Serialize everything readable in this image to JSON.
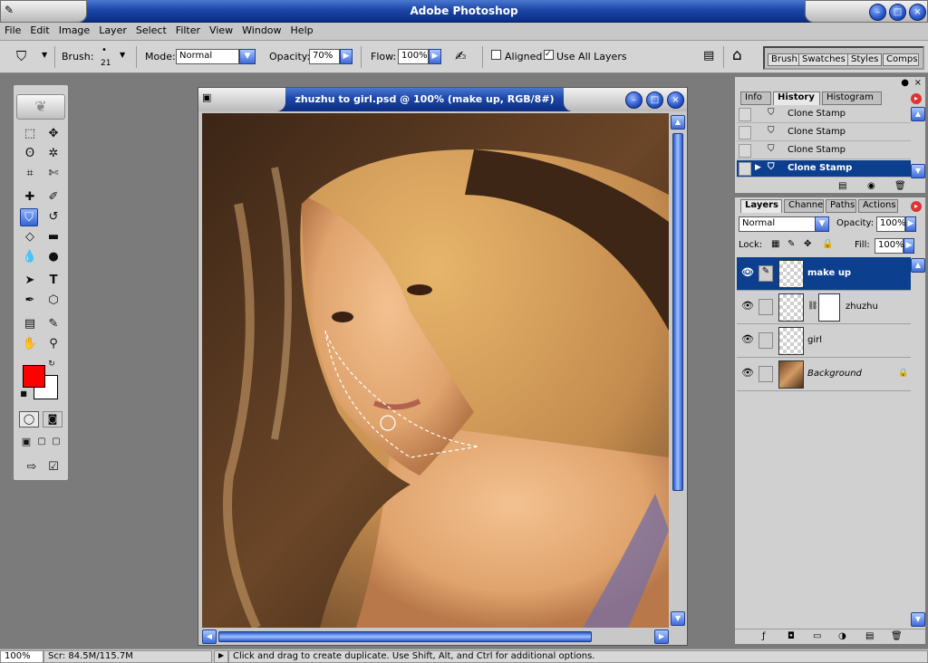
{
  "app": {
    "title": "Adobe Photoshop"
  },
  "menu": [
    "File",
    "Edit",
    "Image",
    "Layer",
    "Select",
    "Filter",
    "View",
    "Window",
    "Help"
  ],
  "options": {
    "brush_label": "Brush:",
    "brush_size": "21",
    "mode_label": "Mode:",
    "mode_value": "Normal",
    "opacity_label": "Opacity:",
    "opacity_value": "70%",
    "flow_label": "Flow:",
    "flow_value": "100%",
    "aligned_label": "Aligned",
    "use_all_layers_label": "Use All Layers",
    "well_tabs": [
      "Brush",
      "Swatches",
      "Styles",
      "Comps"
    ]
  },
  "document": {
    "title": "zhuzhu to girl.psd @ 100% (make up, RGB/8#)"
  },
  "history": {
    "tabs": [
      "Info",
      "History",
      "Histogram"
    ],
    "items": [
      "Clone Stamp",
      "Clone Stamp",
      "Clone Stamp",
      "Clone Stamp"
    ]
  },
  "layers": {
    "tabs": [
      "Layers",
      "Channels",
      "Paths",
      "Actions"
    ],
    "blend_mode": "Normal",
    "opacity_label": "Opacity:",
    "opacity_value": "100%",
    "lock_label": "Lock:",
    "fill_label": "Fill:",
    "fill_value": "100%",
    "items": [
      {
        "name": "make up"
      },
      {
        "name": "zhuzhu"
      },
      {
        "name": "girl"
      },
      {
        "name": "Background"
      }
    ]
  },
  "status": {
    "zoom": "100%",
    "scratch": "Scr: 84.5M/115.7M",
    "hint": "Click and drag to create duplicate.  Use Shift, Alt, and Ctrl for additional options."
  },
  "colors": {
    "foreground": "#ff0000",
    "background": "#ffffff",
    "accent": "#0d3f8f"
  }
}
